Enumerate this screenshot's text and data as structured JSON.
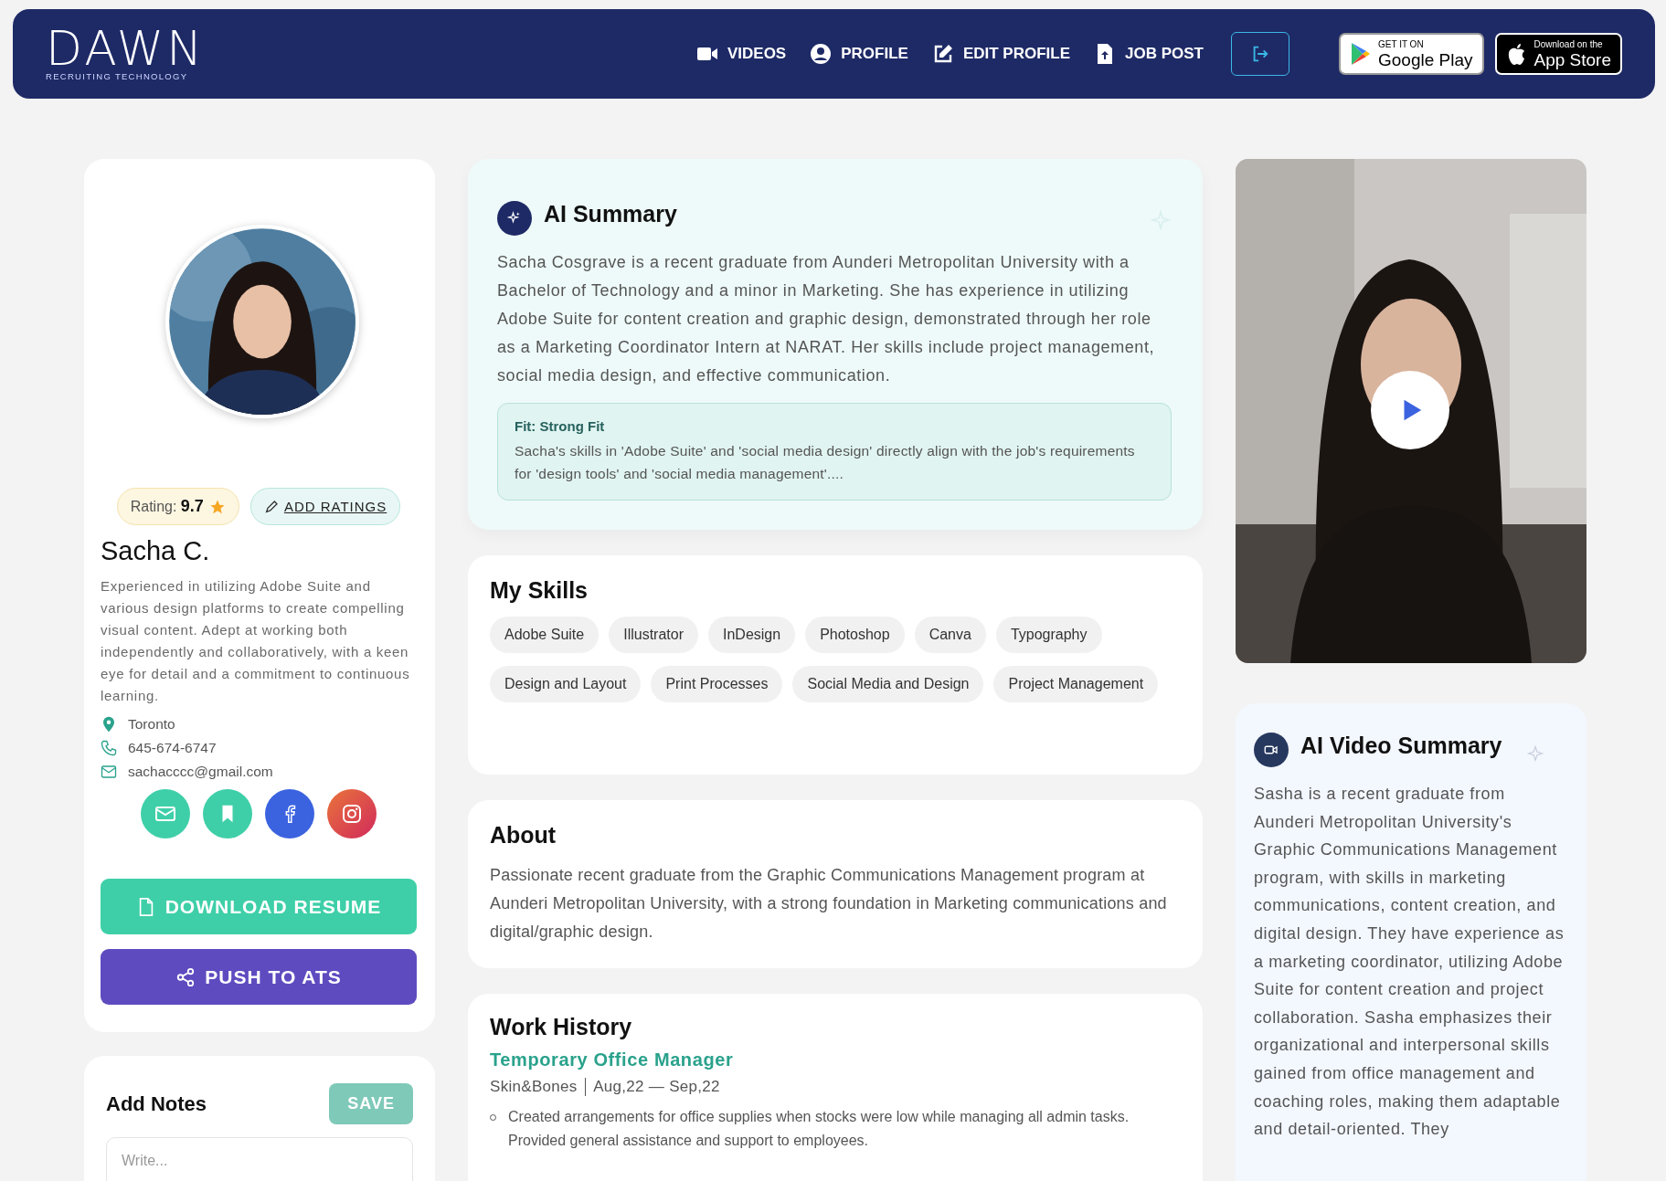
{
  "header": {
    "logo": {
      "name": "DAWN",
      "tagline": "RECRUITING TECHNOLOGY"
    },
    "nav": [
      {
        "label": "VIDEOS",
        "kind": "video"
      },
      {
        "label": "PROFILE",
        "kind": "user"
      },
      {
        "label": "EDIT PROFILE",
        "kind": "edit"
      },
      {
        "label": "JOB POST",
        "kind": "file"
      }
    ],
    "store_badges": [
      {
        "kind": "google",
        "small": "GET IT ON",
        "big": "Google Play"
      },
      {
        "kind": "apple",
        "small": "Download on the",
        "big": "App Store"
      }
    ]
  },
  "profile": {
    "rating": "Rating: **9.7**",
    "add_ratings": "ADD RATINGS",
    "name": "Sacha C.",
    "bio": "Experienced in utilizing Adobe Suite and various design platforms to create compelling visual content. Adept at working both independently and collaboratively, with a keen eye for detail and a commitment to continuous learning.",
    "contacts": [
      {
        "kind": "location",
        "text": "Toronto"
      },
      {
        "kind": "phone",
        "text": "645-674-6747"
      },
      {
        "kind": "email",
        "text": "sachacccc@gmail.com"
      }
    ],
    "socials": [
      {
        "kind": "email"
      },
      {
        "kind": "bookmark"
      },
      {
        "kind": "facebook"
      },
      {
        "kind": "instagram"
      }
    ],
    "buttons": [
      {
        "kind": "download",
        "label": "DOWNLOAD RESUME"
      },
      {
        "kind": "push",
        "label": "PUSH TO ATS"
      }
    ]
  },
  "notes": {
    "title": "Add Notes",
    "save": "SAVE",
    "placeholder": "Write..."
  },
  "ai_summary": {
    "title": "AI Summary",
    "text": "Sacha Cosgrave is a recent graduate from Aunderi Metropolitan University with a Bachelor of Technology and a minor in Marketing. She has experience in utilizing Adobe Suite for content creation and graphic design, demonstrated through her role as a Marketing Coordinator Intern at NARAT. Her skills include project management, social media design, and effective communication.",
    "fit_title": "Fit: Strong Fit",
    "fit_text": "Sacha's skills in 'Adobe Suite' and 'social media design' directly align with the job's requirements for 'design tools' and 'social media management'...."
  },
  "skills": {
    "title": "My Skills",
    "items": [
      "Adobe Suite",
      "Illustrator",
      "InDesign",
      "Photoshop",
      "Canva",
      "Typography",
      "Design and Layout",
      "Print Processes",
      "Social Media and Design",
      "Project Management"
    ]
  },
  "about": {
    "title": "About",
    "text": "Passionate recent graduate from the Graphic Communications Management program at Aunderi Metropolitan University, with a strong foundation in Marketing communications and digital/graphic design."
  },
  "work_history": {
    "title": "Work History",
    "jobs": [
      {
        "title": "Temporary Office Manager",
        "company": "Skin&Bones",
        "dates": "Aug,22 — Sep,22",
        "bullets": [
          "Created arrangements for office supplies when stocks were low while managing all admin tasks. Provided general assistance and support to employees."
        ]
      }
    ]
  },
  "video_summary": {
    "title": "AI Video Summary",
    "text": "Sasha is a recent graduate from Aunderi Metropolitan University's Graphic Communications Management program, with skills in marketing communications, content creation, and digital design. They have experience as a marketing coordinator, utilizing Adobe Suite for content creation and project collaboration. Sasha emphasizes their organizational and interpersonal skills gained from office management and coaching roles, making them adaptable and detail-oriented. They"
  }
}
